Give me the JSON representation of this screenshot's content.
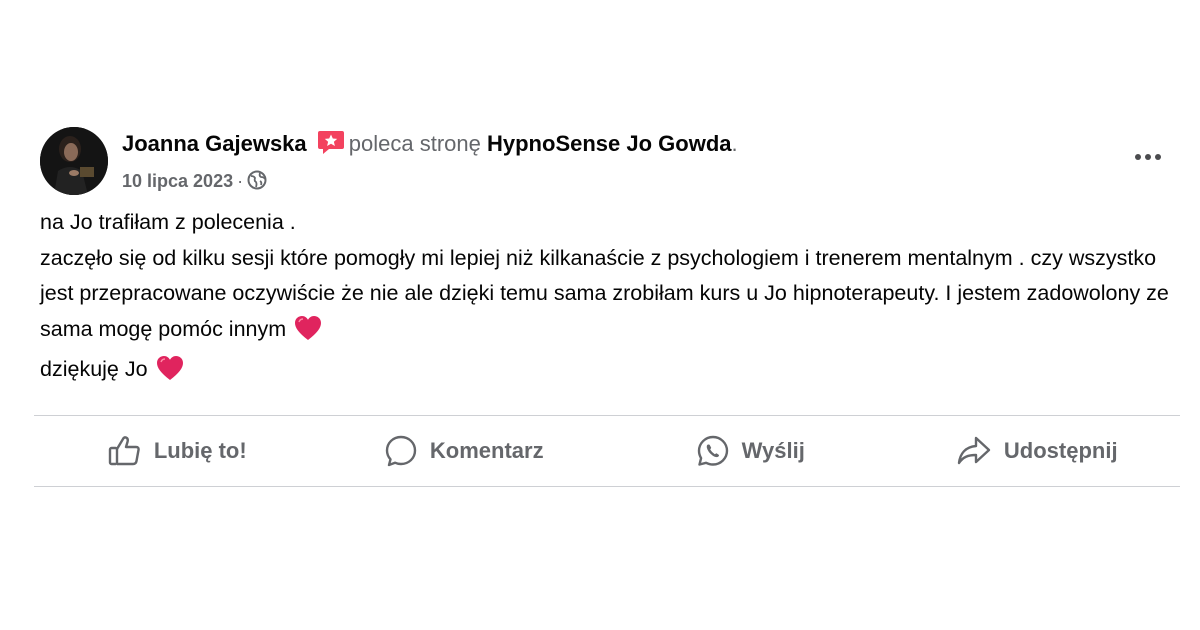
{
  "post": {
    "author": "Joanna Gajewska",
    "verb": "poleca stronę",
    "page_name": "HypnoSense Jo Gowda",
    "page_suffix": ".",
    "date": "10 lipca 2023",
    "separator": "·",
    "privacy_icon": "globe-icon",
    "badge_icon": "recommend-star-icon",
    "body_lines": [
      "na Jo trafiłam z polecenia .",
      "zaczęło się od kilku sesji które pomogły mi lepiej niż kilkanaście z psychologiem i trenerem mentalnym . czy wszystko jest przepracowane oczywiście że nie ale dzięki temu sama zrobiłam kurs u Jo hipnoterapeuty.  I jestem zadowolony ze sama mogę pomóc innym",
      "dziękuję Jo"
    ]
  },
  "actions": {
    "like": "Lubię to!",
    "comment": "Komentarz",
    "send": "Wyślij",
    "share": "Udostępnij"
  },
  "colors": {
    "secondary_text": "#65676b",
    "primary_text": "#050505",
    "badge": "#f3425f",
    "heart": "#e0245e",
    "divider": "#ced0d4"
  }
}
